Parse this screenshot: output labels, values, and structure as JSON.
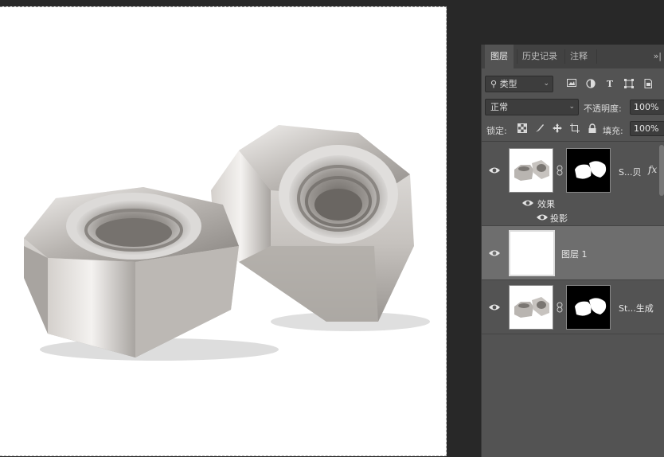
{
  "panel": {
    "tabs": [
      {
        "label": "图层",
        "active": true
      },
      {
        "label": "历史记录",
        "active": false
      },
      {
        "label": "注释",
        "active": false
      }
    ],
    "more": "»|"
  },
  "filter": {
    "kind_label": "类型",
    "icons": [
      "image-filter-icon",
      "adjustment-filter-icon",
      "type-filter-icon",
      "shape-filter-icon",
      "smart-object-filter-icon"
    ]
  },
  "blend": {
    "mode": "正常",
    "opacity_label": "不透明度:",
    "opacity_value": "100%"
  },
  "lock": {
    "label": "锁定:",
    "fill_label": "填充:",
    "fill_value": "100%"
  },
  "layers": [
    {
      "name": "S...贝",
      "has_mask": true,
      "has_fx": true,
      "fx": "fx",
      "selected": false
    },
    {
      "name": "图层 1",
      "has_mask": false,
      "has_fx": false,
      "selected": true
    },
    {
      "name": "St...生成",
      "has_mask": true,
      "has_fx": false,
      "selected": false
    }
  ],
  "effects": {
    "group_label": "效果",
    "items": [
      "投影"
    ]
  },
  "colors": {
    "panel_bg": "#535353",
    "selected_layer": "#6e6e6e",
    "workspace": "#282828"
  }
}
